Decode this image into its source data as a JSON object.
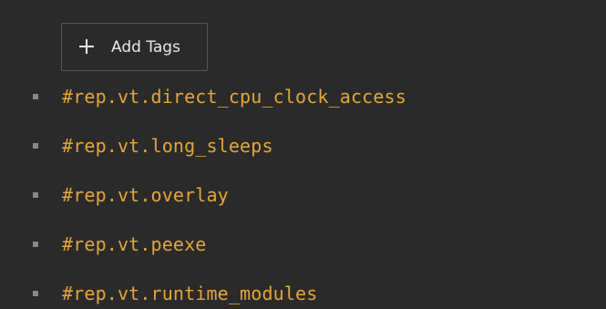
{
  "colors": {
    "background": "#2a2a2a",
    "button_border": "#555555",
    "button_text": "#e8e8e8",
    "tag_text": "#e7a531",
    "bullet": "#888888"
  },
  "actions": {
    "add_tags": {
      "icon": "plus-icon",
      "label": "Add Tags"
    }
  },
  "tags": [
    {
      "label": "#rep.vt.direct_cpu_clock_access"
    },
    {
      "label": "#rep.vt.long_sleeps"
    },
    {
      "label": "#rep.vt.overlay"
    },
    {
      "label": "#rep.vt.peexe"
    },
    {
      "label": "#rep.vt.runtime_modules"
    }
  ]
}
